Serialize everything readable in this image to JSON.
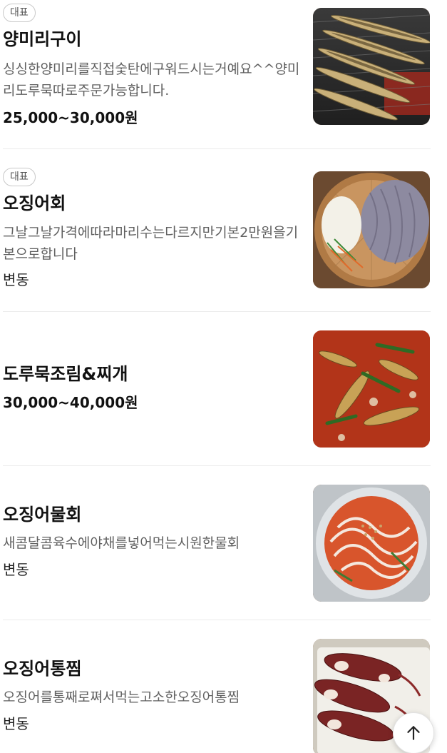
{
  "menu": {
    "items": [
      {
        "badge": "대표",
        "name": "양미리구이",
        "description": "싱싱한양미리를직접숯탄에구워드시는거예요^^양미리도루묵따로주문가능합니다.",
        "price": "25,000~30,000원",
        "image_icon": "grilled-sandfish-photo"
      },
      {
        "badge": "대표",
        "name": "오징어회",
        "description": "그날그날가격에따라마리수는다르지만기본2만원을기본으로합니다",
        "price": "변동",
        "image_icon": "squid-sashimi-photo"
      },
      {
        "name": "도루묵조림&찌개",
        "price": "30,000~40,000원",
        "image_icon": "braised-sailfin-sandfish-photo"
      },
      {
        "name": "오징어물회",
        "description": "새콤달콤육수에야채를넣어먹는시원한물회",
        "price": "변동",
        "image_icon": "cold-raw-squid-soup-photo"
      },
      {
        "name": "오징어통찜",
        "description": "오징어를통째로쪄서먹는고소한오징어통찜",
        "price": "변동",
        "image_icon": "steamed-whole-squid-photo"
      }
    ]
  },
  "scroll_top": {
    "icon": "arrow-up-icon"
  }
}
